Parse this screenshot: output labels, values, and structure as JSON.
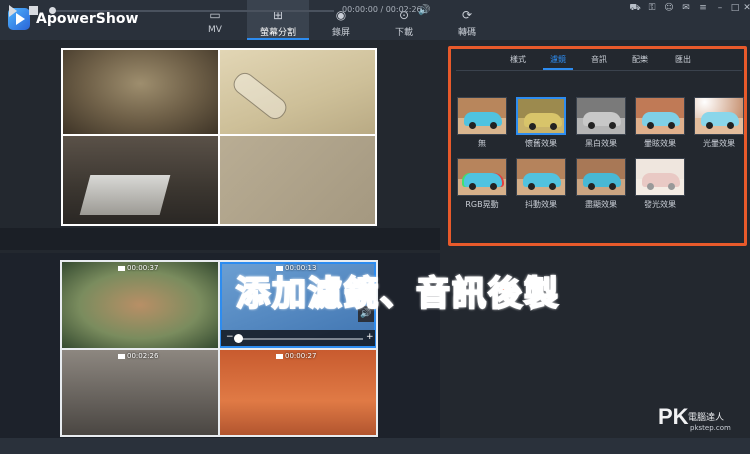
{
  "app": {
    "title": "ApowerShow"
  },
  "nav": {
    "tabs": [
      {
        "label": "MV",
        "icon": "tv-icon"
      },
      {
        "label": "螢幕分割",
        "icon": "split-screen-icon"
      },
      {
        "label": "錄屏",
        "icon": "record-icon"
      },
      {
        "label": "下載",
        "icon": "download-icon"
      },
      {
        "label": "轉碼",
        "icon": "convert-icon"
      }
    ],
    "active_index": 1
  },
  "window_controls": [
    "cart-icon",
    "lock-icon",
    "user-icon",
    "mail-icon",
    "menu-icon",
    "minimize-icon",
    "maximize-icon",
    "close-icon"
  ],
  "player": {
    "time_current": "00:00:00",
    "time_separator": " / ",
    "time_total": "00:02:26"
  },
  "panel": {
    "tabs": [
      "樣式",
      "濾鏡",
      "音訊",
      "配樂",
      "匯出"
    ],
    "active_tab_index": 1,
    "filters": [
      {
        "label": "無",
        "selected": false
      },
      {
        "label": "懷舊效果",
        "selected": true
      },
      {
        "label": "黑白效果",
        "selected": false
      },
      {
        "label": "暈眩效果",
        "selected": false
      },
      {
        "label": "光暈效果",
        "selected": false
      },
      {
        "label": "RGB晃動",
        "selected": false
      },
      {
        "label": "抖動效果",
        "selected": false
      },
      {
        "label": "盡顯效果",
        "selected": false
      },
      {
        "label": "發光效果",
        "selected": false
      }
    ]
  },
  "timeline": {
    "clips": [
      {
        "duration": "00:00:37"
      },
      {
        "duration": "00:00:13"
      },
      {
        "duration": "00:02:26"
      },
      {
        "duration": "00:00:27"
      }
    ]
  },
  "caption": "添加濾鏡、音訊後製",
  "watermark": {
    "brand": "PK",
    "sub": "電腦達人",
    "url": "pkstep.com"
  },
  "colors": {
    "accent": "#2d8cf0",
    "highlight": "#e85a2b",
    "caption": "#ff4d1a"
  }
}
